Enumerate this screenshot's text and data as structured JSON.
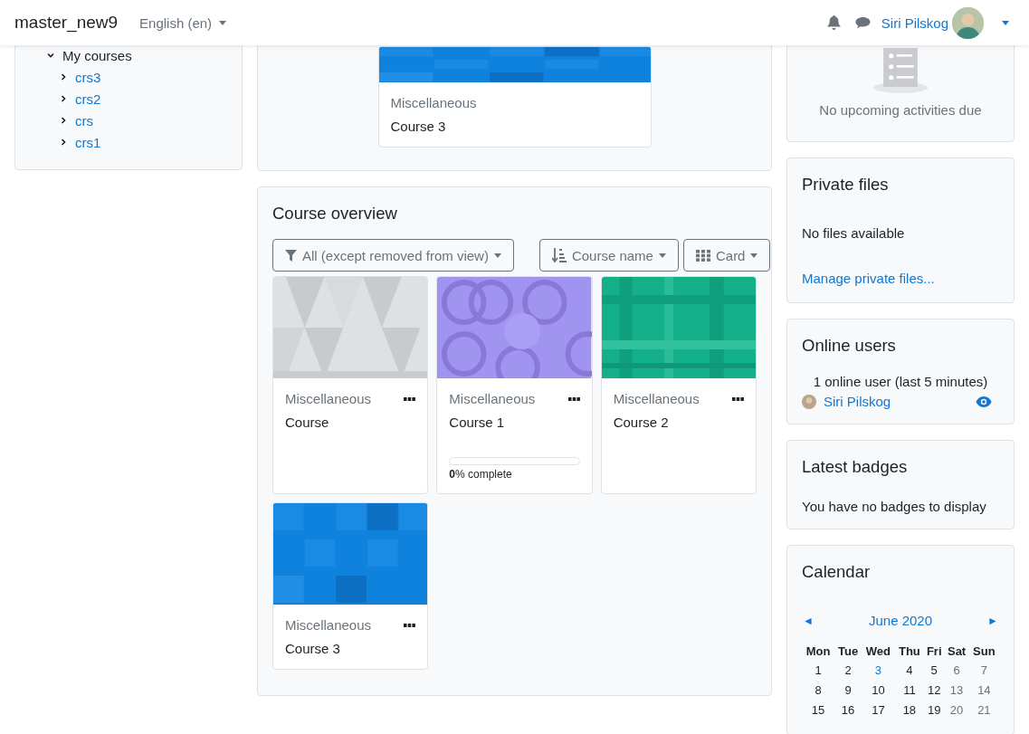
{
  "navbar": {
    "site_name": "master_new9",
    "language": "English (en)",
    "user_name": "Siri Pilskog"
  },
  "navigation": {
    "items": [
      {
        "label": "My courses",
        "expanded": true,
        "children": [
          {
            "label": "crs3",
            "expanded": false
          },
          {
            "label": "crs2",
            "expanded": false
          },
          {
            "label": "crs",
            "expanded": false
          },
          {
            "label": "crs1",
            "expanded": false
          }
        ]
      }
    ]
  },
  "recent_course": {
    "category": "Miscellaneous",
    "name": "Course 3"
  },
  "course_overview": {
    "title": "Course overview",
    "filter": "All (except removed from view)",
    "sort": "Course name",
    "view": "Card",
    "courses": [
      {
        "category": "Miscellaneous",
        "name": "Course"
      },
      {
        "category": "Miscellaneous",
        "name": "Course 1",
        "progress": {
          "level": 0,
          "label": "**0**% complete"
        }
      },
      {
        "category": "Miscellaneous",
        "name": "Course 2"
      },
      {
        "category": "Miscellaneous",
        "name": "Course 3"
      }
    ]
  },
  "timeline": {
    "empty_text": "No upcoming activities due"
  },
  "private_files": {
    "title": "Private files",
    "empty_text": "No files available",
    "link": "Manage private files..."
  },
  "online_users": {
    "title": "Online users",
    "summary": "1 online user (last 5 minutes)",
    "users": [
      {
        "name": "Siri Pilskog"
      }
    ]
  },
  "badges": {
    "title": "Latest badges",
    "empty_text": "You have no badges to display"
  },
  "calendar": {
    "title": "Calendar",
    "prev": "◄",
    "month": "June 2020",
    "next": "►",
    "weekdays": [
      "Mon",
      "Tue",
      "Wed",
      "Thu",
      "Fri",
      "Sat",
      "Sun"
    ],
    "weeks": [
      [
        {
          "day": "1",
          "kind": "weekday"
        },
        {
          "day": "2",
          "kind": "weekday"
        },
        {
          "day": "3",
          "kind": "today"
        },
        {
          "day": "4",
          "kind": "weekday"
        },
        {
          "day": "5",
          "kind": "weekday"
        },
        {
          "day": "6",
          "kind": "weekend"
        },
        {
          "day": "7",
          "kind": "weekend"
        }
      ],
      [
        {
          "day": "8",
          "kind": "weekday"
        },
        {
          "day": "9",
          "kind": "weekday"
        },
        {
          "day": "10",
          "kind": "weekday"
        },
        {
          "day": "11",
          "kind": "weekday"
        },
        {
          "day": "12",
          "kind": "weekday"
        },
        {
          "day": "13",
          "kind": "weekend"
        },
        {
          "day": "14",
          "kind": "weekend"
        }
      ],
      [
        {
          "day": "15",
          "kind": "weekday"
        },
        {
          "day": "16",
          "kind": "weekday"
        },
        {
          "day": "17",
          "kind": "weekday"
        },
        {
          "day": "18",
          "kind": "weekday"
        },
        {
          "day": "19",
          "kind": "weekday"
        },
        {
          "day": "20",
          "kind": "weekend"
        },
        {
          "day": "21",
          "kind": "weekend"
        }
      ]
    ]
  }
}
